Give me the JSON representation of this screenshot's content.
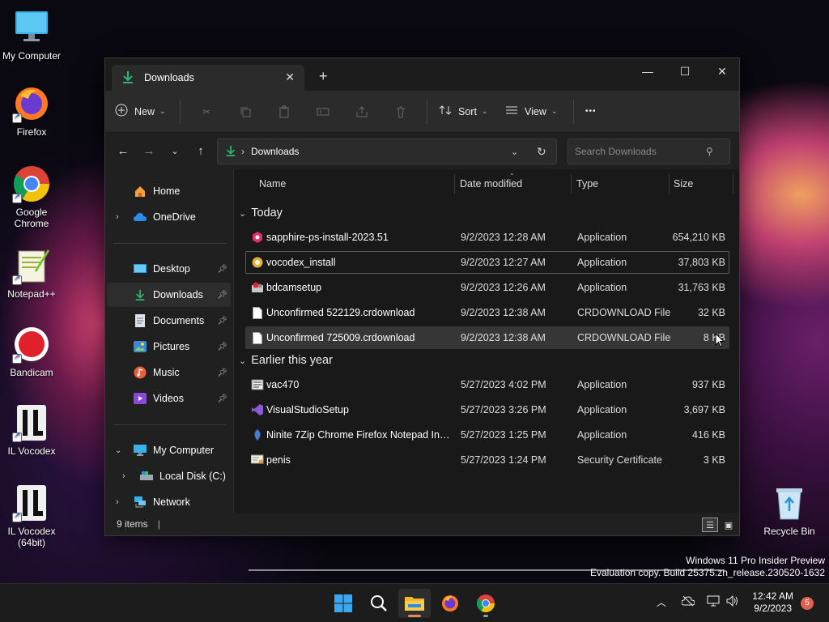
{
  "desktop": {
    "icons": [
      {
        "label": "My Computer"
      },
      {
        "label": "Firefox"
      },
      {
        "label": "Google Chrome"
      },
      {
        "label": "Notepad++"
      },
      {
        "label": "Bandicam"
      },
      {
        "label": "IL Vocodex"
      },
      {
        "label": "IL Vocodex (64bit)"
      },
      {
        "label": "Recycle Bin"
      }
    ]
  },
  "window": {
    "tab_title": "Downloads",
    "new_tab_glyph": "+",
    "controls": {
      "minimize": "—",
      "maximize": "☐",
      "close": "✕"
    }
  },
  "toolbar": {
    "new_label": "New",
    "sort_label": "Sort",
    "view_label": "View",
    "more_glyph": "•••"
  },
  "address": {
    "path": "Downloads",
    "search_placeholder": "Search Downloads"
  },
  "sidebar": {
    "home": "Home",
    "onedrive": "OneDrive",
    "desktop": "Desktop",
    "downloads": "Downloads",
    "documents": "Documents",
    "pictures": "Pictures",
    "music": "Music",
    "videos": "Videos",
    "my_computer": "My Computer",
    "local_disk": "Local Disk (C:)",
    "network": "Network"
  },
  "columns": {
    "name": "Name",
    "date": "Date modified",
    "type": "Type",
    "size": "Size"
  },
  "groups": {
    "today": "Today",
    "earlier": "Earlier this year"
  },
  "files_today": [
    {
      "name": "sapphire-ps-install-2023.51",
      "date": "9/2/2023 12:28 AM",
      "type": "Application",
      "size": "654,210 KB",
      "icon": "sapphire-app-icon"
    },
    {
      "name": "vocodex_install",
      "date": "9/2/2023 12:27 AM",
      "type": "Application",
      "size": "37,803 KB",
      "icon": "vocodex-installer-icon"
    },
    {
      "name": "bdcamsetup",
      "date": "9/2/2023 12:26 AM",
      "type": "Application",
      "size": "31,763 KB",
      "icon": "bandicam-setup-icon"
    },
    {
      "name": "Unconfirmed 522129.crdownload",
      "date": "9/2/2023 12:38 AM",
      "type": "CRDOWNLOAD File",
      "size": "32 KB",
      "icon": "blank-file-icon"
    },
    {
      "name": "Unconfirmed 725009.crdownload",
      "date": "9/2/2023 12:38 AM",
      "type": "CRDOWNLOAD File",
      "size": "8 KB",
      "icon": "blank-file-icon"
    }
  ],
  "files_earlier": [
    {
      "name": "vac470",
      "date": "5/27/2023 4:02 PM",
      "type": "Application",
      "size": "937 KB",
      "icon": "vac-app-icon"
    },
    {
      "name": "VisualStudioSetup",
      "date": "5/27/2023 3:26 PM",
      "type": "Application",
      "size": "3,697 KB",
      "icon": "visual-studio-icon"
    },
    {
      "name": "Ninite 7Zip Chrome Firefox Notepad Inst...",
      "date": "5/27/2023 1:25 PM",
      "type": "Application",
      "size": "416 KB",
      "icon": "ninite-icon"
    },
    {
      "name": "penis",
      "date": "5/27/2023 1:24 PM",
      "type": "Security Certificate",
      "size": "3 KB",
      "icon": "certificate-icon"
    }
  ],
  "status": {
    "item_count": "9 items",
    "cursor_glyph": "|"
  },
  "watermark": {
    "line1": "Windows 11 Pro Insider Preview",
    "line2": "Evaluation copy. Build 25375.zn_release.230520-1632"
  },
  "taskbar": {
    "time": "12:42 AM",
    "date": "9/2/2023",
    "notification_count": "5"
  }
}
